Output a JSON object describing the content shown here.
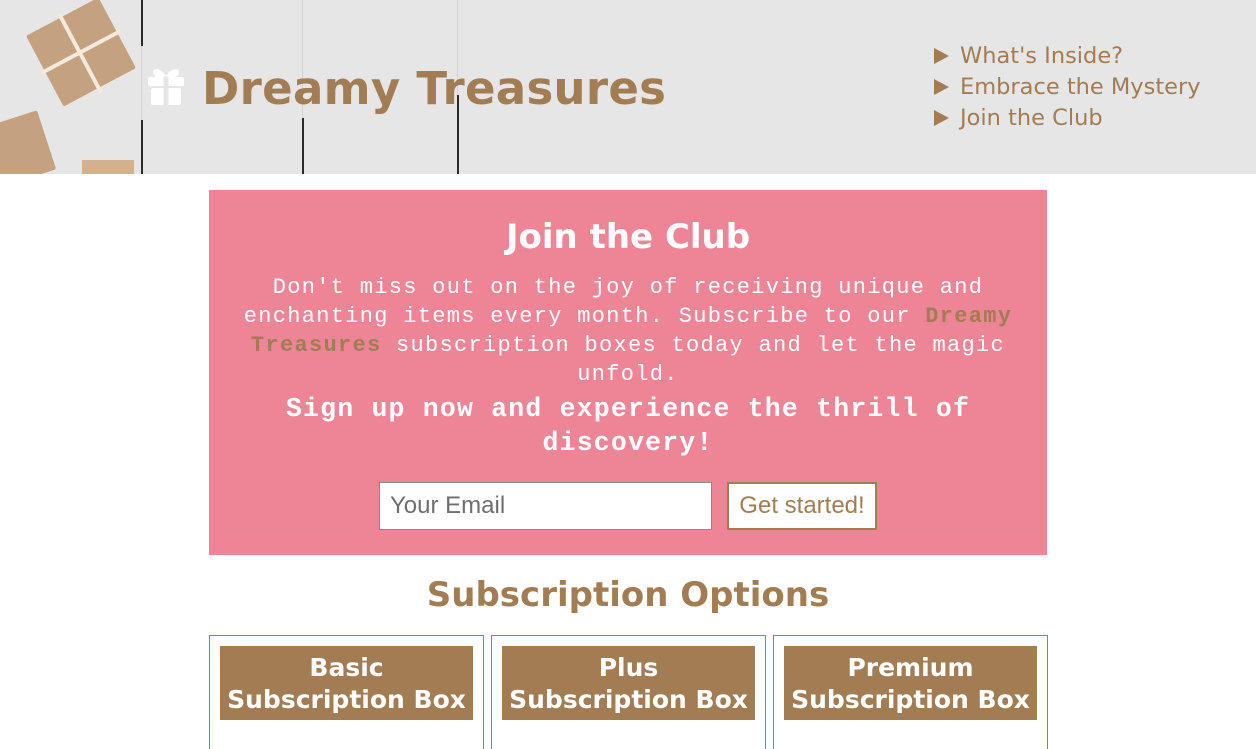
{
  "header": {
    "brand": "Dreamy Treasures",
    "nav": [
      "What's Inside?",
      "Embrace the Mystery",
      "Join the Club"
    ]
  },
  "join": {
    "title": "Join the Club",
    "body_before": "Don't miss out on the joy of receiving unique and enchanting items every month. Subscribe to our ",
    "body_brand": "Dreamy Treasures",
    "body_after": " subscription boxes today and let the magic unfold.",
    "cta": "Sign up now and experience the thrill of discovery!",
    "email_placeholder": "Your Email",
    "submit_label": "Get started!"
  },
  "options": {
    "title": "Subscription Options",
    "cards": [
      {
        "line1": "Basic",
        "line2": "Subscription Box"
      },
      {
        "line1": "Plus",
        "line2": "Subscription Box"
      },
      {
        "line1": "Premium",
        "line2": "Subscription Box"
      }
    ]
  },
  "colors": {
    "accent": "#a27c53",
    "panel": "#ed8597",
    "header_bg": "#e6e6e6"
  }
}
